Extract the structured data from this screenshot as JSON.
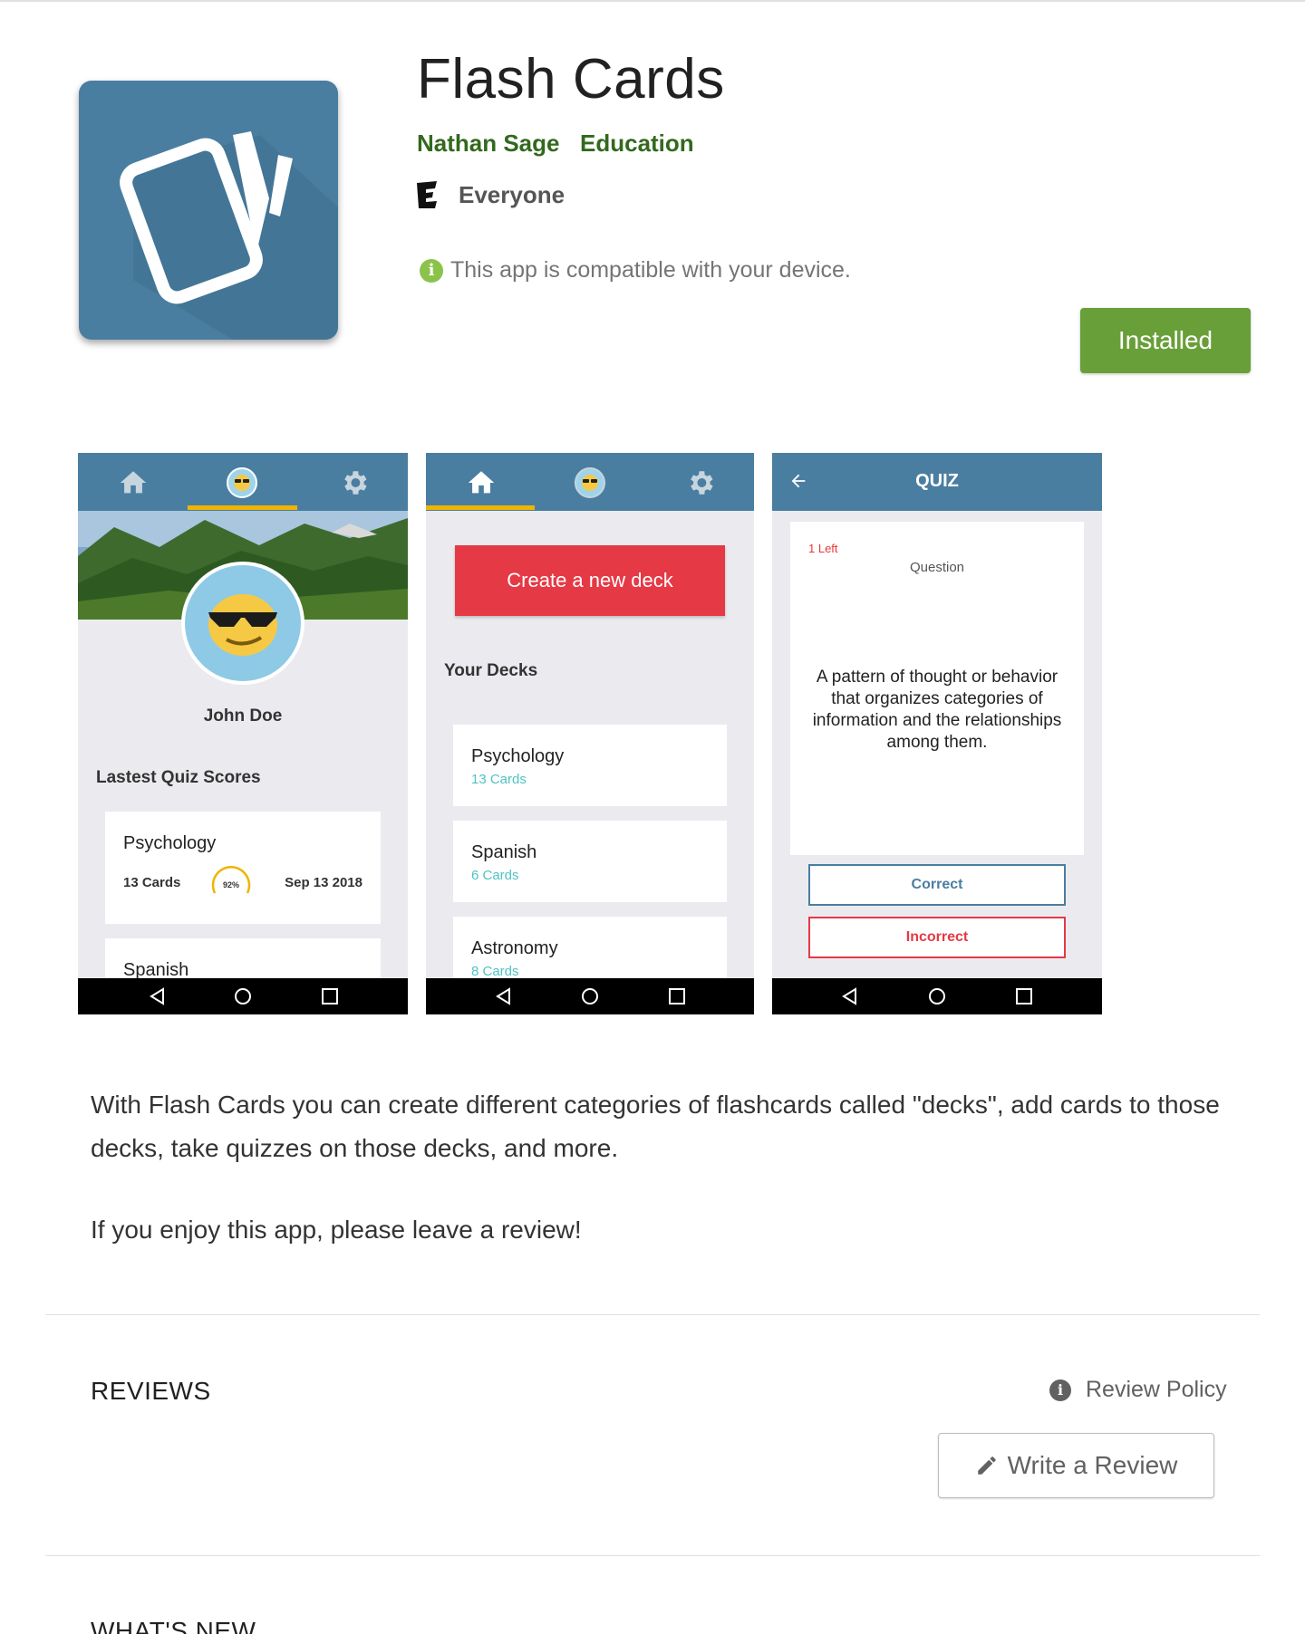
{
  "app": {
    "title": "Flash Cards",
    "developer": "Nathan Sage",
    "category": "Education",
    "content_rating": "Everyone",
    "rating_icon": "E",
    "compatibility": "This app is compatible with your device.",
    "install_label": "Installed"
  },
  "screens": {
    "profile": {
      "user_name": "John Doe",
      "section_title": "Lastest Quiz Scores",
      "score_card": {
        "deck": "Psychology",
        "cards": "13 Cards",
        "percent": "92%",
        "date": "Sep 13 2018"
      },
      "next_card": "Spanish"
    },
    "decks": {
      "create_label": "Create a new deck",
      "section_title": "Your Decks",
      "items": [
        {
          "name": "Psychology",
          "count": "13 Cards"
        },
        {
          "name": "Spanish",
          "count": "6 Cards"
        },
        {
          "name": "Astronomy",
          "count": "8 Cards"
        }
      ]
    },
    "quiz": {
      "title": "QUIZ",
      "left": "1 Left",
      "label": "Question",
      "text": "A pattern of thought or behavior that organizes categories of information and the relationships among them.",
      "correct": "Correct",
      "incorrect": "Incorrect"
    }
  },
  "description": {
    "paragraph1": "With Flash Cards you can create different categories of flashcards called \"decks\", add cards to those decks, take quizzes on those decks, and more.",
    "paragraph2": "If you enjoy this app, please leave a review!"
  },
  "reviews": {
    "heading": "REVIEWS",
    "policy_label": "Review Policy",
    "write_label": "Write a Review"
  },
  "whats_new": {
    "heading": "WHAT'S NEW"
  },
  "colors": {
    "brand_green": "#689f38",
    "dev_green": "#33691e",
    "app_blue": "#4a7ea0",
    "accent_yellow": "#f0b400",
    "create_red": "#e63946",
    "cards_teal": "#4fc3c3"
  }
}
